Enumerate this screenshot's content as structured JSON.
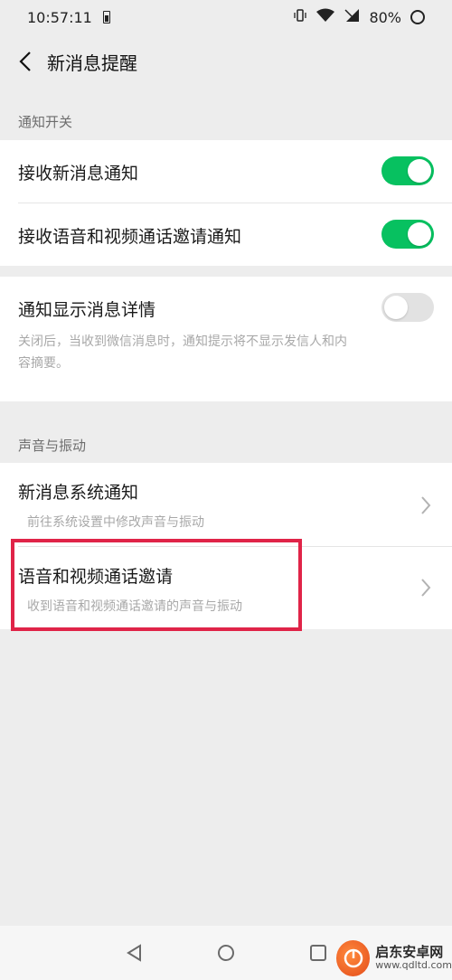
{
  "status_bar": {
    "time": "10:57:11",
    "battery_percent": "80%"
  },
  "nav": {
    "title": "新消息提醒"
  },
  "sections": {
    "notification_switch": {
      "header": "通知开关",
      "rows": [
        {
          "title": "接收新消息通知",
          "toggle": true
        },
        {
          "title": "接收语音和视频通话邀请通知",
          "toggle": true
        }
      ]
    },
    "detail": {
      "title": "通知显示消息详情",
      "toggle": false,
      "subtitle_line1": "关闭后，当收到微信消息时，通知提示将不显示发信人和内",
      "subtitle_line2": "容摘要。"
    },
    "sound_vibration": {
      "header": "声音与振动",
      "rows": [
        {
          "title": "新消息系统通知",
          "subtitle": "前往系统设置中修改声音与振动"
        },
        {
          "title": "语音和视频通话邀请",
          "subtitle": "收到语音和视频通话邀请的声音与振动"
        }
      ]
    }
  },
  "colors": {
    "toggle_on": "#07c160",
    "toggle_off": "#e2e2e2",
    "highlight": "#e02448",
    "background": "#ededed"
  },
  "icons": {
    "back": "chevron-left-icon",
    "row_arrow": "chevron-right-icon",
    "nav_back": "triangle-back-icon",
    "nav_home": "circle-home-icon",
    "nav_recent": "square-recent-icon"
  },
  "watermark": {
    "title": "启东安卓网",
    "url": "www.qdltd.com"
  }
}
